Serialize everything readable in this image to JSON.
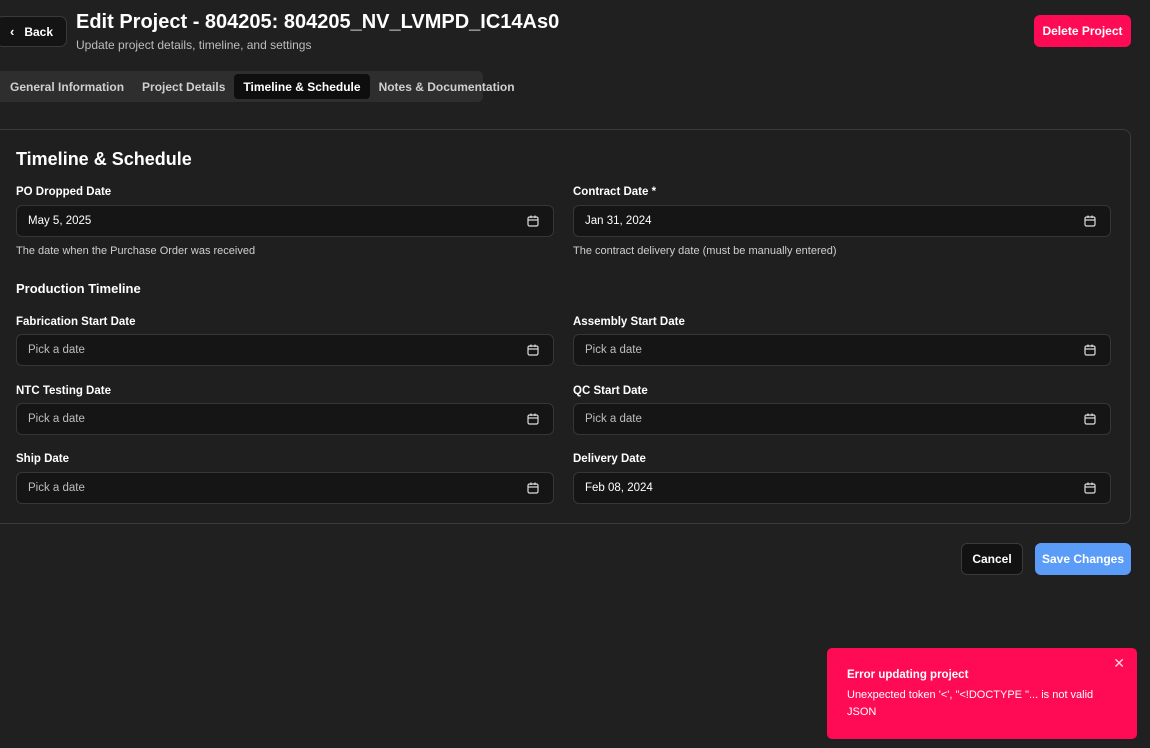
{
  "header": {
    "back_label": "Back",
    "title": "Edit Project - 804205: 804205_NV_LVMPD_IC14As0",
    "subtitle": "Update project details, timeline, and settings",
    "delete_label": "Delete Project"
  },
  "tabs": [
    {
      "label": "General Information",
      "active": false
    },
    {
      "label": "Project Details",
      "active": false
    },
    {
      "label": "Timeline & Schedule",
      "active": true
    },
    {
      "label": "Notes & Documentation",
      "active": false
    }
  ],
  "card": {
    "title": "Timeline & Schedule",
    "po_dropped": {
      "label": "PO Dropped Date",
      "value": "May 5, 2025",
      "hint": "The date when the Purchase Order was received"
    },
    "contract": {
      "label": "Contract Date *",
      "value": "Jan 31, 2024",
      "hint": "The contract delivery date (must be manually entered)"
    },
    "production_title": "Production Timeline",
    "fabrication": {
      "label": "Fabrication Start Date",
      "placeholder": "Pick a date"
    },
    "assembly": {
      "label": "Assembly Start Date",
      "placeholder": "Pick a date"
    },
    "ntc": {
      "label": "NTC Testing Date",
      "placeholder": "Pick a date"
    },
    "qc": {
      "label": "QC Start Date",
      "placeholder": "Pick a date"
    },
    "ship": {
      "label": "Ship Date",
      "placeholder": "Pick a date"
    },
    "delivery": {
      "label": "Delivery Date",
      "value": "Feb 08, 2024"
    }
  },
  "actions": {
    "cancel_label": "Cancel",
    "save_label": "Save Changes"
  },
  "toast": {
    "title": "Error updating project",
    "message": "Unexpected token '<', \"<!DOCTYPE \"... is not valid JSON",
    "close_symbol": "✕"
  },
  "colors": {
    "background": "#202020",
    "danger": "#ff0a55",
    "primary": "#5a9cf8"
  },
  "icons": [
    "chevron-left-icon",
    "calendar-icon",
    "close-icon"
  ]
}
